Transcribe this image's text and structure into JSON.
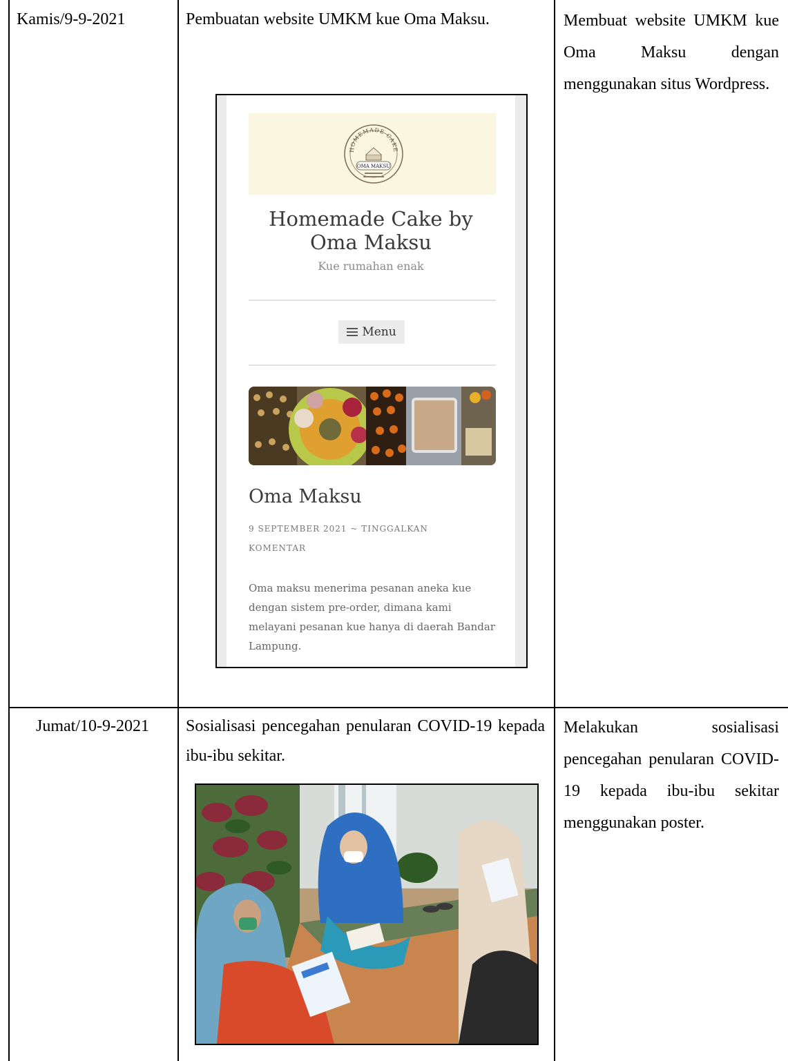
{
  "rows": [
    {
      "date": "Kamis/9-9-2021",
      "activity": "Pembuatan website UMKM kue Oma Maksu.",
      "result": "Membuat website UMKM kue Oma Maksu dengan menggunakan situs Wordpress."
    },
    {
      "date": "Jumat/10-9-2021",
      "activity": "Sosialisasi pencegahan penularan COVID-19 kepada ibu-ibu sekitar.",
      "result": "Melakukan sosialisasi pencegahan penularan COVID-19 kepada ibu-ibu sekitar menggunakan poster."
    }
  ],
  "website": {
    "logo_text_top": "HOMEMADE CAKE",
    "logo_text_banner": "OMA MAKSU",
    "site_title": "Homemade Cake by Oma Maksu",
    "tagline": "Kue rumahan enak",
    "menu_label": "Menu",
    "post_title": "Oma Maksu",
    "post_meta": "9 SEPTEMBER 2021 ~ TINGGALKAN KOMENTAR",
    "post_body": "Oma maksu menerima pesanan aneka kue dengan sistem pre-order, dimana kami melayani pesanan kue hanya di daerah Bandar Lampung."
  },
  "icons": {
    "menu": "hamburger-icon"
  }
}
